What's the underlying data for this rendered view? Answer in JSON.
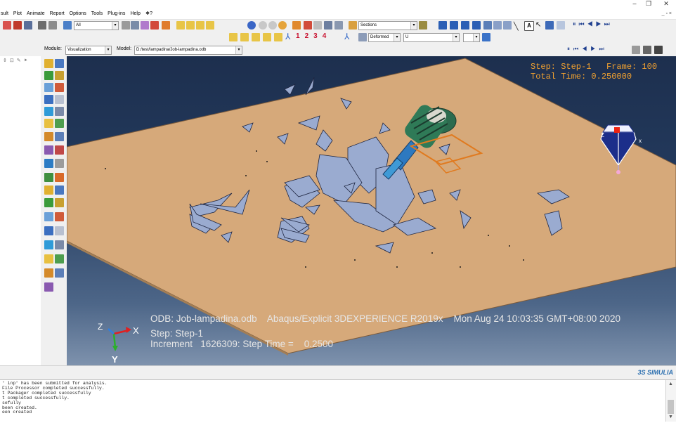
{
  "window": {
    "minimize_glyph": "–",
    "restore_glyph": "❐",
    "close_glyph": "✕",
    "inner_controls": "_ ▫ ×"
  },
  "menubar": {
    "items": [
      "sult",
      "Plot",
      "Animate",
      "Report",
      "Options",
      "Tools",
      "Plug-ins",
      "Help",
      "❖?"
    ]
  },
  "toolbar": {
    "selection_filter": "All",
    "sections_combo": "Sections",
    "deformed_combo": "Deformed",
    "variable_combo": "U",
    "step_numbers": [
      "1",
      "2",
      "3",
      "4"
    ]
  },
  "context": {
    "module_label": "Module:",
    "module_value": "Visualization",
    "model_label": "Model:",
    "model_value": "D:/test/lampadina/Job-lampadina.odb"
  },
  "viewport": {
    "step_line": "Step: Step-1   Frame: 100",
    "time_line": "Total Time: 0.250000",
    "odb_line": "ODB: Job-lampadina.odb    Abaqus/Explicit 3DEXPERIENCE R2019x    Mon Aug 24 10:03:35 GMT+08:00 2020",
    "step_caption": "Step: Step-1",
    "increment_line": "Increment   1626309: Step Time =    0.2500",
    "triad_labels": {
      "x": "X",
      "y": "Y",
      "z": "Z"
    },
    "view_cube_labels": {
      "x": "x",
      "z": "Z"
    },
    "colors": {
      "background_top": "#1d2f4e",
      "background_bottom": "#7e92ad",
      "plate": "#d6a97a",
      "fragment": "#9aabd0",
      "orange_text": "#f0a030"
    }
  },
  "brand": "3S SIMULIA",
  "messages": [
    "' inp' has been submitted for analysis.",
    "File Processor completed successfully.",
    "t Packager completed successfully",
    "t completed successfully.",
    "sefully",
    "been created.",
    "een created"
  ]
}
